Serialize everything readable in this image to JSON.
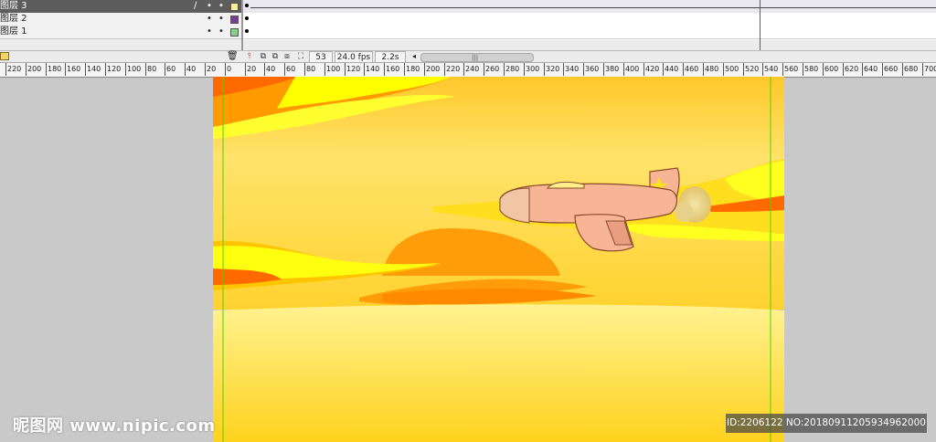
{
  "timeline": {
    "layers": [
      {
        "name": "图层 3",
        "color": "#f5f08c",
        "selected": true
      },
      {
        "name": "图层 2",
        "color": "#7a3a9a",
        "selected": false
      },
      {
        "name": "图层 1",
        "color": "#86d186",
        "selected": false
      }
    ],
    "frame_number": "53",
    "fps": "24.0 fps",
    "time": "2.2s"
  },
  "ruler": {
    "labels": [
      "220",
      "200",
      "180",
      "160",
      "140",
      "120",
      "100",
      "80",
      "60",
      "40",
      "20",
      "0",
      "20",
      "40",
      "60",
      "80",
      "100",
      "120",
      "140",
      "160",
      "180",
      "200",
      "220",
      "240",
      "260",
      "280",
      "300",
      "320",
      "340",
      "360",
      "380",
      "400",
      "420",
      "440",
      "460",
      "480",
      "500",
      "520",
      "540",
      "560",
      "580",
      "600",
      "620",
      "640",
      "660",
      "680",
      "700"
    ]
  },
  "colors": {
    "sky_top": "#ffc82a",
    "sky_mid": "#ffe36a",
    "sky_low": "#ffd22e",
    "ground_top": "#ffef8a",
    "ground_bottom": "#ffd21e",
    "cloud_yellow": "#ffff00",
    "cloud_orange": "#ff9a00",
    "cloud_dark": "#ff6a00",
    "sun": "#ff9c0a",
    "plane_body": "#f7b596",
    "plane_outline": "#8a4a2a",
    "canvas_bg": "#c9c9c9",
    "guide_line": "#4cd400"
  },
  "watermark": {
    "text": "昵图网 www.nipic.com",
    "id_text": "ID:2206122 NO:20180911205934962000"
  }
}
